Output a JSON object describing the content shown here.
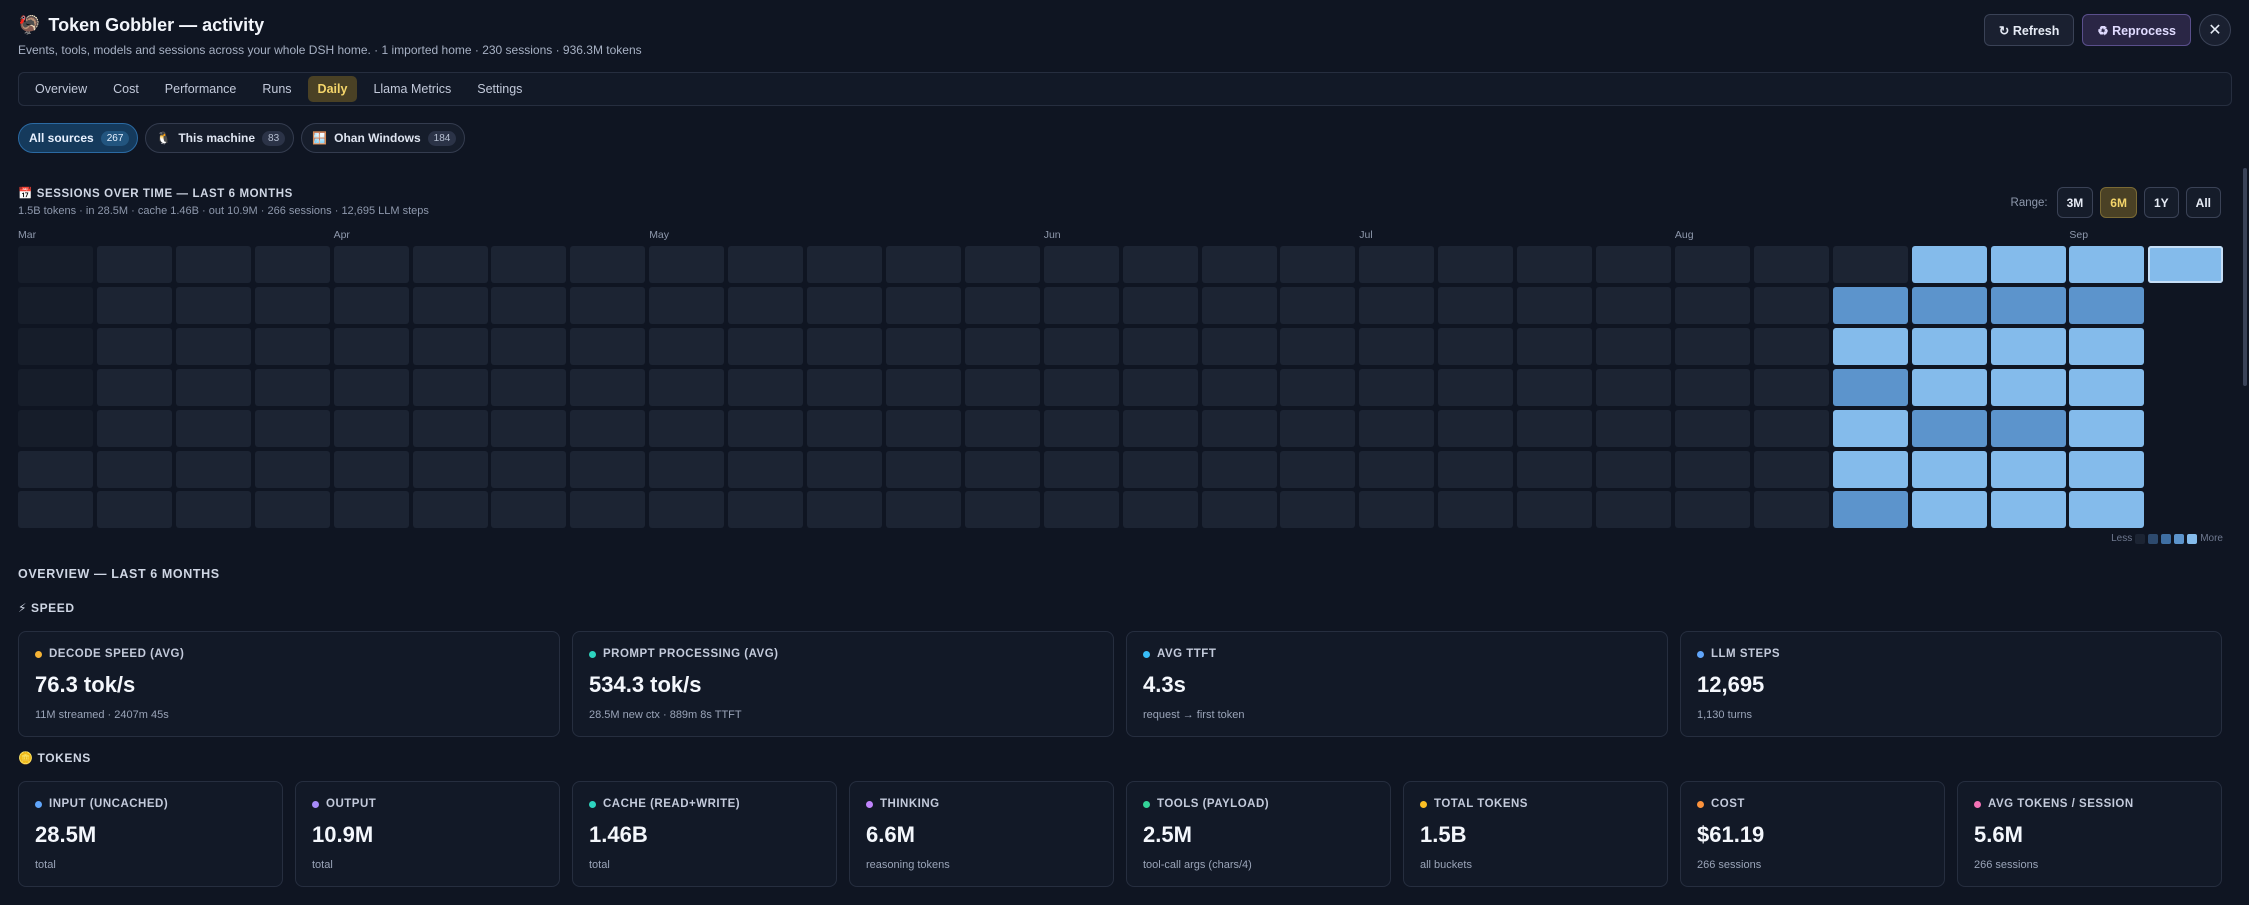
{
  "header": {
    "icon": "🦃",
    "title": "Token Gobbler — activity",
    "subtitle": "Events, tools, models and sessions across your whole DSH home. · 1 imported home · 230 sessions · 936.3M tokens",
    "refresh_label": "↻ Refresh",
    "reprocess_label": "♻ Reprocess",
    "close_label": "✕"
  },
  "tabs": [
    "Overview",
    "Cost",
    "Performance",
    "Runs",
    "Daily",
    "Llama Metrics",
    "Settings"
  ],
  "active_tab": "Daily",
  "sources": [
    {
      "label": "All sources",
      "icon": "",
      "count": "267",
      "active": true
    },
    {
      "label": "This machine",
      "icon": "🐧",
      "count": "83",
      "active": false
    },
    {
      "label": "Ohan Windows",
      "icon": "🪟",
      "count": "184",
      "active": false
    }
  ],
  "heatmap": {
    "title": "📅 SESSIONS OVER TIME — LAST 6 MONTHS",
    "subtitle": "1.5B tokens · in 28.5M · cache 1.46B · out 10.9M · 266 sessions · 12,695 LLM steps",
    "range_label": "Range:",
    "ranges": [
      "3M",
      "6M",
      "1Y",
      "All"
    ],
    "active_range": "6M",
    "months": [
      {
        "label": "Mar",
        "week": 0
      },
      {
        "label": "Apr",
        "week": 4
      },
      {
        "label": "May",
        "week": 8
      },
      {
        "label": "Jun",
        "week": 13
      },
      {
        "label": "Jul",
        "week": 17
      },
      {
        "label": "Aug",
        "week": 21
      },
      {
        "label": "Sep",
        "week": 26
      }
    ],
    "weeks": 28,
    "rows": 7,
    "faint_cells": [
      [
        0,
        0
      ],
      [
        0,
        1
      ],
      [
        0,
        2
      ],
      [
        0,
        3
      ],
      [
        0,
        4
      ]
    ],
    "active_cells": [
      {
        "w": 24,
        "d": 0,
        "level": 2
      },
      {
        "w": 25,
        "d": 0,
        "level": 2
      },
      {
        "w": 26,
        "d": 0,
        "level": 2
      },
      {
        "w": 27,
        "d": 0,
        "level": 2,
        "selected": true
      },
      {
        "w": 23,
        "d": 1,
        "level": 1
      },
      {
        "w": 24,
        "d": 1,
        "level": 1
      },
      {
        "w": 25,
        "d": 1,
        "level": 1
      },
      {
        "w": 26,
        "d": 1,
        "level": 1
      },
      {
        "w": 23,
        "d": 2,
        "level": 2
      },
      {
        "w": 24,
        "d": 2,
        "level": 2
      },
      {
        "w": 25,
        "d": 2,
        "level": 2
      },
      {
        "w": 26,
        "d": 2,
        "level": 2
      },
      {
        "w": 23,
        "d": 3,
        "level": 1
      },
      {
        "w": 24,
        "d": 3,
        "level": 2
      },
      {
        "w": 25,
        "d": 3,
        "level": 2
      },
      {
        "w": 26,
        "d": 3,
        "level": 2
      },
      {
        "w": 23,
        "d": 4,
        "level": 2
      },
      {
        "w": 24,
        "d": 4,
        "level": 1
      },
      {
        "w": 25,
        "d": 4,
        "level": 1
      },
      {
        "w": 26,
        "d": 4,
        "level": 2
      },
      {
        "w": 23,
        "d": 5,
        "level": 2
      },
      {
        "w": 24,
        "d": 5,
        "level": 2
      },
      {
        "w": 25,
        "d": 5,
        "level": 2
      },
      {
        "w": 26,
        "d": 5,
        "level": 2
      },
      {
        "w": 23,
        "d": 6,
        "level": 1
      },
      {
        "w": 24,
        "d": 6,
        "level": 2
      },
      {
        "w": 25,
        "d": 6,
        "level": 2
      },
      {
        "w": 26,
        "d": 6,
        "level": 2
      }
    ],
    "empty_cells": [
      [
        27,
        1
      ],
      [
        27,
        2
      ],
      [
        27,
        3
      ],
      [
        27,
        4
      ],
      [
        27,
        5
      ],
      [
        27,
        6
      ]
    ],
    "legend_less": "Less",
    "legend_more": "More",
    "legend_colors": [
      "#1c2433",
      "#2d4a6e",
      "#3f6fa3",
      "#5c94cc",
      "#84bbeb"
    ]
  },
  "overview": {
    "title": "OVERVIEW — LAST 6 MONTHS",
    "speed_title": "⚡ SPEED",
    "speed_cards": [
      {
        "label": "DECODE SPEED (AVG)",
        "value": "76.3 tok/s",
        "note": "11M streamed · 2407m 45s",
        "color": "#f5b335"
      },
      {
        "label": "PROMPT PROCESSING (AVG)",
        "value": "534.3 tok/s",
        "note": "28.5M new ctx · 889m 8s TTFT",
        "color": "#2dd4bf"
      },
      {
        "label": "AVG TTFT",
        "value": "4.3s",
        "note": "request → first token",
        "color": "#38bdf8"
      },
      {
        "label": "LLM STEPS",
        "value": "12,695",
        "note": "1,130 turns",
        "color": "#60a5fa"
      }
    ],
    "tokens_title": "🪙 TOKENS",
    "token_cards": [
      {
        "label": "INPUT (UNCACHED)",
        "value": "28.5M",
        "note": "total",
        "color": "#60a5fa"
      },
      {
        "label": "OUTPUT",
        "value": "10.9M",
        "note": "total",
        "color": "#a78bfa"
      },
      {
        "label": "CACHE (READ+WRITE)",
        "value": "1.46B",
        "note": "total",
        "color": "#2dd4bf"
      },
      {
        "label": "THINKING",
        "value": "6.6M",
        "note": "reasoning tokens",
        "color": "#c084fc"
      },
      {
        "label": "TOOLS (PAYLOAD)",
        "value": "2.5M",
        "note": "tool-call args (chars/4)",
        "color": "#34d399"
      },
      {
        "label": "TOTAL TOKENS",
        "value": "1.5B",
        "note": "all buckets",
        "color": "#fbbf24"
      },
      {
        "label": "COST",
        "value": "$61.19",
        "note": "266 sessions",
        "color": "#fb923c"
      },
      {
        "label": "AVG TOKENS / SESSION",
        "value": "5.6M",
        "note": "266 sessions",
        "color": "#f472b6"
      }
    ]
  }
}
